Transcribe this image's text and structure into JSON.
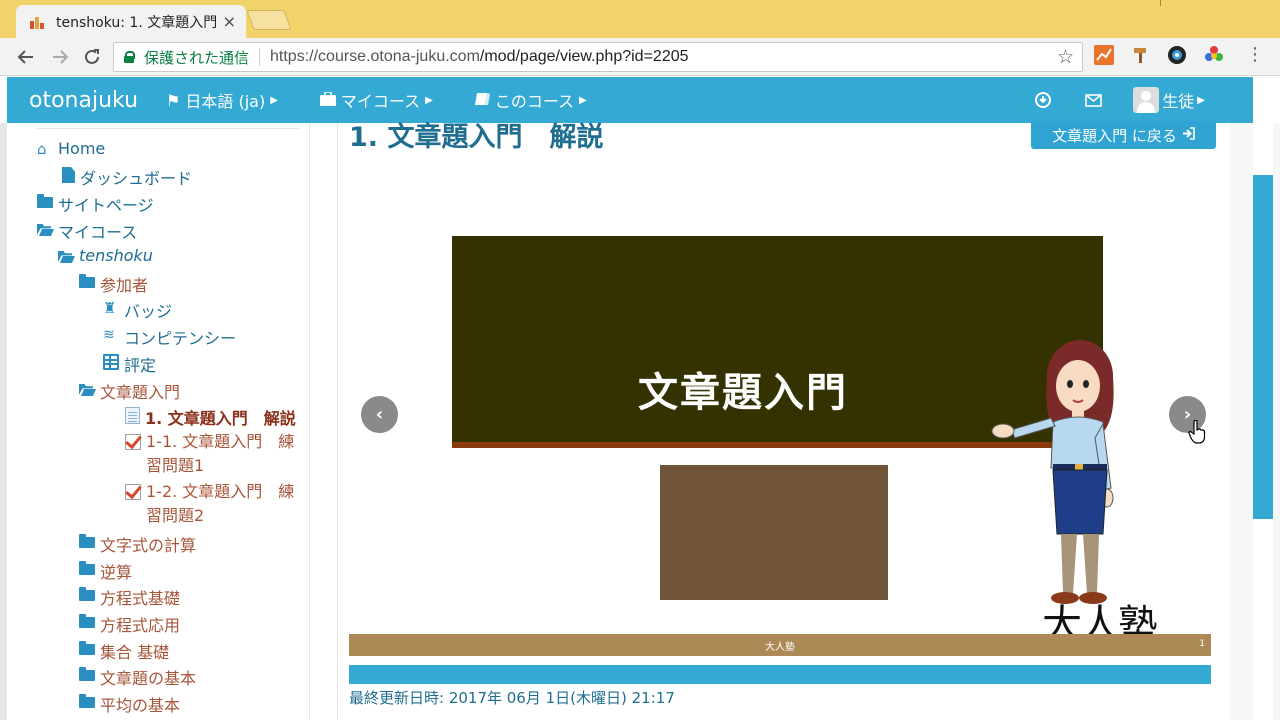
{
  "browser": {
    "tab_title": "tenshoku: 1. 文章題入門",
    "tab_close": "×",
    "secure_label": "保護された通信",
    "url_host": "https://course.otona-juku.com",
    "url_path": "/mod/page/view.php?id=2205",
    "back_icon": "arrow-left-icon",
    "forward_icon": "arrow-right-icon",
    "reload_icon": "reload-icon",
    "bookmark_icon": "star-icon"
  },
  "navbar": {
    "brand": "otonajuku",
    "language": "日本語 (ja)",
    "my_courses": "マイコース",
    "this_course": "このコース",
    "user": "生徒",
    "color": "#34a9d3"
  },
  "tree": {
    "home": "Home",
    "dashboard": "ダッシュボード",
    "site_pages": "サイトページ",
    "my_courses": "マイコース",
    "course": "tenshoku",
    "participants": "参加者",
    "badges": "バッジ",
    "competencies": "コンピテンシー",
    "grades": "評定",
    "section_active": "文章題入門",
    "page_active": "1. 文章題入門　解説",
    "quiz1": "1-1. 文章題入門　練習問題1",
    "quiz2": "1-2. 文章題入門　練習問題2",
    "sections": [
      "文字式の計算",
      "逆算",
      "方程式基礎",
      "方程式応用",
      "集合 基礎",
      "文章題の基本",
      "平均の基本"
    ]
  },
  "main": {
    "page_title": "1. 文章題入門　解説",
    "back_button": "文章題入門 に戻る",
    "slide_title": "文章題入門",
    "slide_logo": "大人塾",
    "slide_footer": "大人塾",
    "slide_number": "1",
    "prev_label": "‹",
    "next_label": "›",
    "last_modified": "最終更新日時: 2017年 06月 1日(木曜日) 21:17"
  }
}
